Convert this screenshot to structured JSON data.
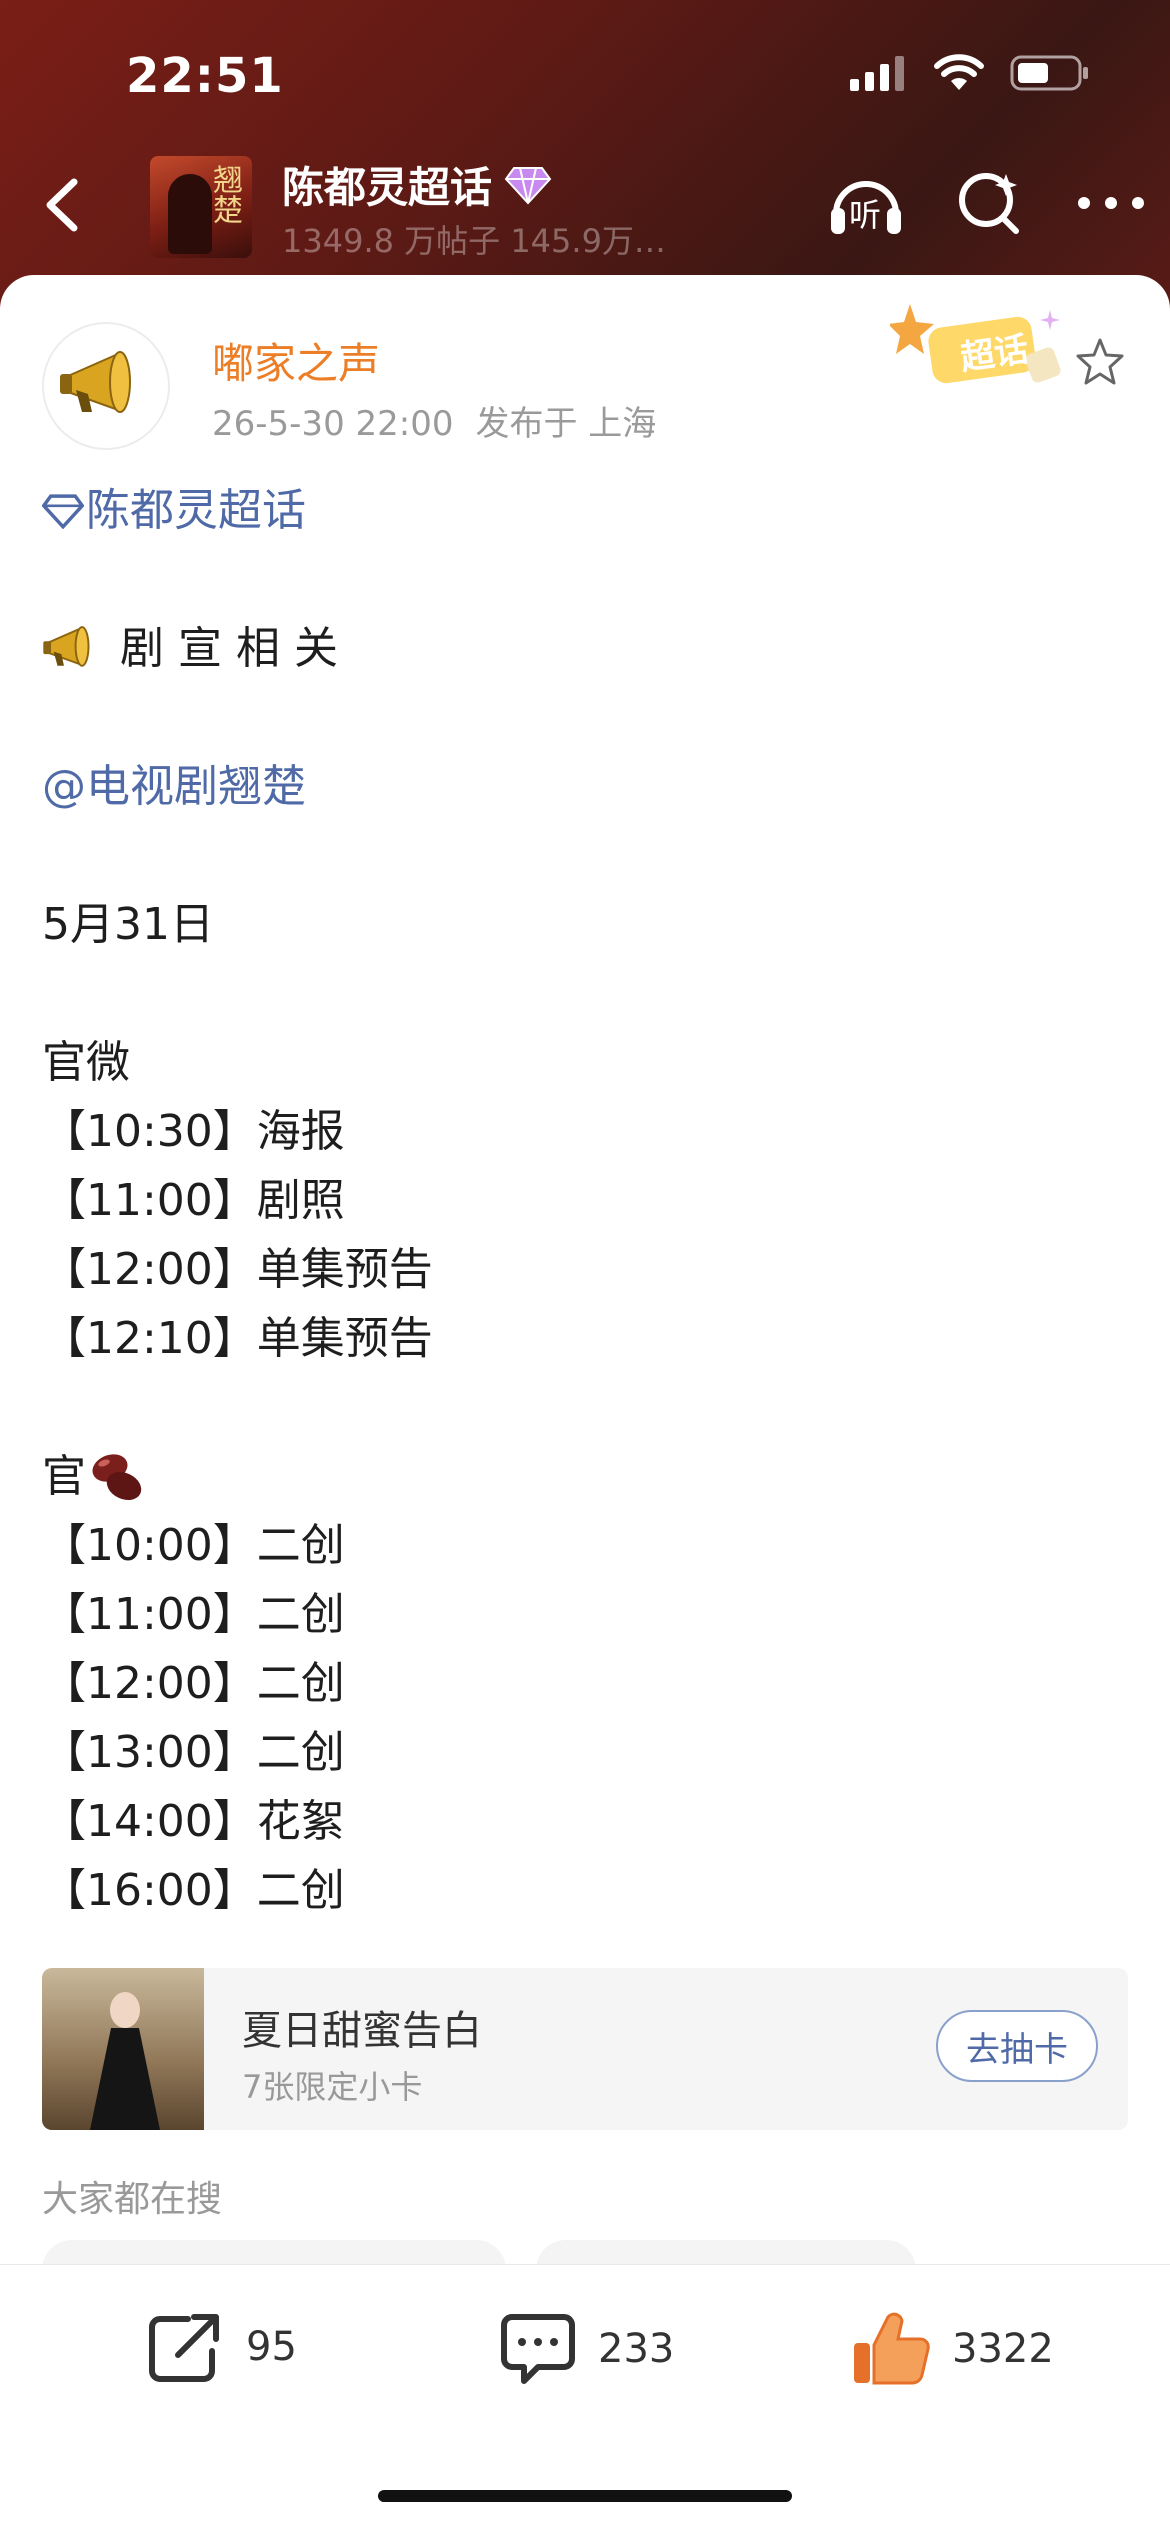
{
  "status": {
    "time": "22:51"
  },
  "header": {
    "topic_title": "陈都灵超话",
    "topic_stats": "1349.8 万帖子 145.9万…",
    "thumb_text": "翘楚",
    "listen_label": "听"
  },
  "post": {
    "author": "嘟家之声",
    "timestamp": "26-5-30 22:00",
    "location": "发布于 上海",
    "badge_label": "超话",
    "lines": {
      "topic_tag": "陈都灵超话",
      "heading": "剧 宣 相 关",
      "mention": "@电视剧翘楚",
      "date": "5月31日",
      "section1": "官微",
      "s1_1": "【10:30】海报",
      "s1_2": "【11:00】剧照",
      "s1_3": "【12:00】单集预告",
      "s1_4": "【12:10】单集预告",
      "section2": "官",
      "s2_1": "【10:00】二创",
      "s2_2": "【11:00】二创",
      "s2_3": "【12:00】二创",
      "s2_4": "【13:00】二创",
      "s2_5": "【14:00】花絮",
      "s2_6": "【16:00】二创"
    }
  },
  "card": {
    "title": "夏日甜蜜告白",
    "subtitle": "7张限定小卡",
    "button": "去抽卡"
  },
  "search_section": {
    "title": "大家都在搜"
  },
  "actions": {
    "share_count": "95",
    "comment_count": "233",
    "like_count": "3322"
  },
  "colors": {
    "header_bg": "#6a1c16",
    "author": "#eb7e27",
    "link": "#4f6aa6",
    "like": "#f08a3c"
  },
  "icons": [
    "back-icon",
    "diamond-icon",
    "headphones-icon",
    "search-icon",
    "more-icon",
    "megaphone-icon",
    "star-icon",
    "beans-emoji",
    "share-icon",
    "comment-icon",
    "like-icon"
  ]
}
